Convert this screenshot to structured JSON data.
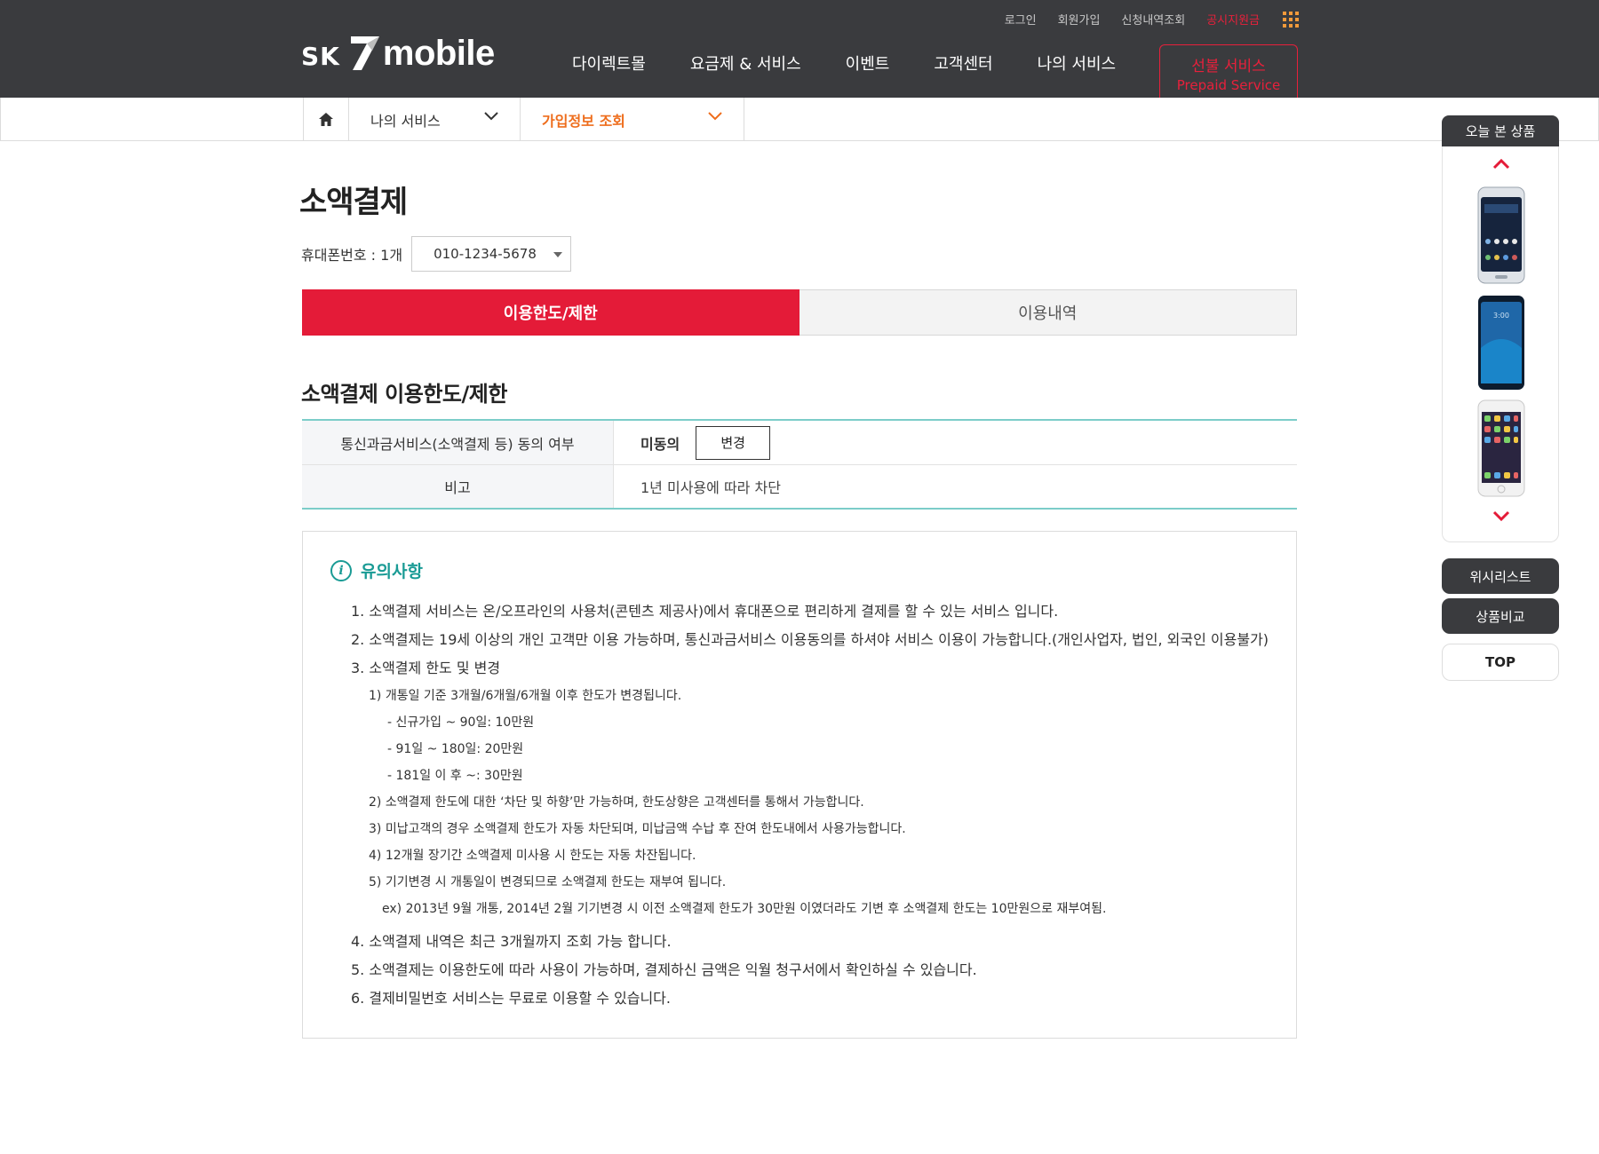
{
  "header": {
    "logo": {
      "sk": "SK",
      "mobile": "mobile"
    },
    "util_links": [
      "로그인",
      "회원가입",
      "신청내역조회",
      "공시지원금"
    ],
    "gnb": [
      "다이렉트몰",
      "요금제 & 서비스",
      "이벤트",
      "고객센터",
      "나의 서비스"
    ],
    "prepaid": {
      "title": "선불 서비스",
      "subtitle": "Prepaid Service"
    }
  },
  "subnav": {
    "level1": "나의 서비스",
    "level2": "가입정보 조회"
  },
  "page": {
    "title": "소액결제",
    "phone_label": "휴대폰번호 : 1개",
    "phone_value": "010-1234-5678",
    "tabs": [
      {
        "label": "이용한도/제한",
        "active": true
      },
      {
        "label": "이용내역",
        "active": false
      }
    ],
    "section_title": "소액결제 이용한도/제한",
    "info_rows": [
      {
        "label": "통신과금서비스(소액결제 등) 동의 여부",
        "value": "미동의",
        "button": "변경"
      },
      {
        "label": "비고",
        "value": "1년 미사용에 따라 차단"
      }
    ]
  },
  "notice": {
    "title": "유의사항",
    "lines": [
      "1. 소액결제 서비스는 온/오프라인의 사용처(콘텐츠 제공사)에서 휴대폰으로 편리하게 결제를 할 수 있는 서비스 입니다.",
      "2. 소액결제는 19세 이상의 개인 고객만 이용 가능하며, 통신과금서비스 이용동의를 하셔야 서비스 이용이 가능합니다.(개인사업자, 법인, 외국인 이용불가)",
      "3. 소액결제 한도 및 변경",
      "1) 개통일 기준 3개월/6개월/6개월 이후 한도가 변경됩니다.",
      "- 신규가입 ~ 90일: 10만원",
      "- 91일 ~ 180일: 20만원",
      "- 181일 이 후 ~: 30만원",
      "2) 소액결제 한도에 대한 ‘차단 및 하향’만 가능하며, 한도상향은 고객센터를 통해서 가능합니다.",
      "3) 미납고객의 경우 소액결제 한도가 자동 차단되며, 미납금액 수납 후 잔여 한도내에서 사용가능합니다.",
      "4) 12개월 장기간 소액결제 미사용 시 한도는 자동 차잔됩니다.",
      "5) 기기변경 시 개통일이 변경되므로 소액결제 한도는 재부여 됩니다.",
      "ex) 2013년 9월 개통, 2014년 2월 기기변경 시 이전 소액결제 한도가 30만원 이였더라도 기변 후 소액결제 한도는 10만원으로 재부여됨.",
      "4. 소액결제 내역은 최근 3개월까지 조회 가능 합니다.",
      "5. 소액결제는 이용한도에 따라 사용이 가능하며, 결제하신 금액은 익월 청구서에서 확인하실 수 있습니다.",
      "6. 결제비밀번호 서비스는 무료로 이용할 수 있습니다."
    ]
  },
  "quick": {
    "tab": "오늘 본 상품",
    "wishlist": "위시리스트",
    "compare": "상품비교",
    "top": "TOP"
  },
  "colors": {
    "header_bg": "#3a3b3e",
    "accent_red": "#e41b38",
    "accent_orange": "#ee6d1c",
    "teal": "#1a9b95"
  }
}
